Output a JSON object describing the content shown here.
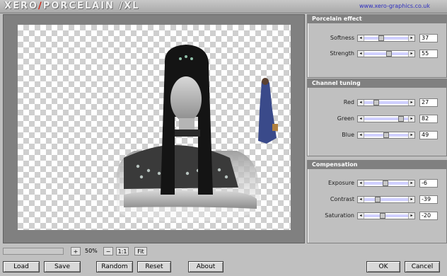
{
  "header": {
    "logo_part1": "XERO",
    "logo_sep1": "∕",
    "logo_part2": "PORCELAIN",
    "logo_sep2": "/",
    "logo_part3": "XL",
    "url": "www.xero-graphics.co.uk"
  },
  "panels": {
    "porcelain": {
      "title": "Porcelain effect",
      "sliders": [
        {
          "label": "Softness",
          "value": "37",
          "level": 0.37
        },
        {
          "label": "Strength",
          "value": "55",
          "level": 0.55
        }
      ]
    },
    "channel": {
      "title": "Channel tuning",
      "sliders": [
        {
          "label": "Red",
          "value": "27",
          "level": 0.27
        },
        {
          "label": "Green",
          "value": "82",
          "level": 0.82
        },
        {
          "label": "Blue",
          "value": "49",
          "level": 0.49
        }
      ]
    },
    "compensation": {
      "title": "Compensation",
      "sliders": [
        {
          "label": "Exposure",
          "value": "-6",
          "level": 0.47
        },
        {
          "label": "Contrast",
          "value": "-39",
          "level": 0.3
        },
        {
          "label": "Saturation",
          "value": "-20",
          "level": 0.4
        }
      ]
    }
  },
  "zoom": {
    "plus": "+",
    "value": "50%",
    "minus": "−",
    "one_to_one": "1:1",
    "fit": "Fit"
  },
  "buttons": {
    "load": "Load",
    "save": "Save",
    "random": "Random",
    "reset": "Reset",
    "about": "About",
    "ok": "OK",
    "cancel": "Cancel"
  },
  "icons": {
    "slider_left": "arrow-left-icon",
    "slider_right": "arrow-right-icon"
  }
}
